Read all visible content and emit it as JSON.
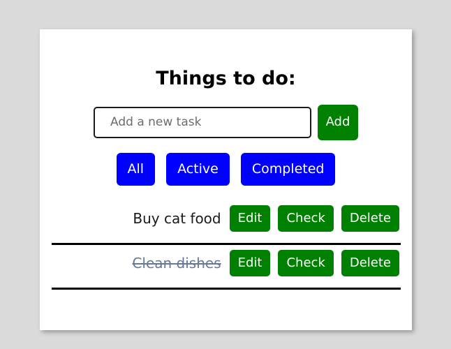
{
  "app": {
    "title": "Things to do:",
    "background_color": "#dadada",
    "card_color": "#ffffff"
  },
  "add_form": {
    "input_value": "",
    "input_placeholder": "Add a new task",
    "add_label": "Add",
    "add_color": "#008000"
  },
  "filters": {
    "color": "#0000ff",
    "items": [
      {
        "label": "All"
      },
      {
        "label": "Active"
      },
      {
        "label": "Completed"
      }
    ]
  },
  "task_actions": {
    "edit_label": "Edit",
    "check_label": "Check",
    "delete_label": "Delete",
    "button_color": "#008000"
  },
  "tasks": [
    {
      "label": "Buy cat food",
      "completed": false,
      "edit_label": "Edit",
      "check_label": "Check",
      "delete_label": "Delete"
    },
    {
      "label": "Clean dishes",
      "completed": true,
      "edit_label": "Edit",
      "check_label": "Check",
      "delete_label": "Delete"
    }
  ]
}
